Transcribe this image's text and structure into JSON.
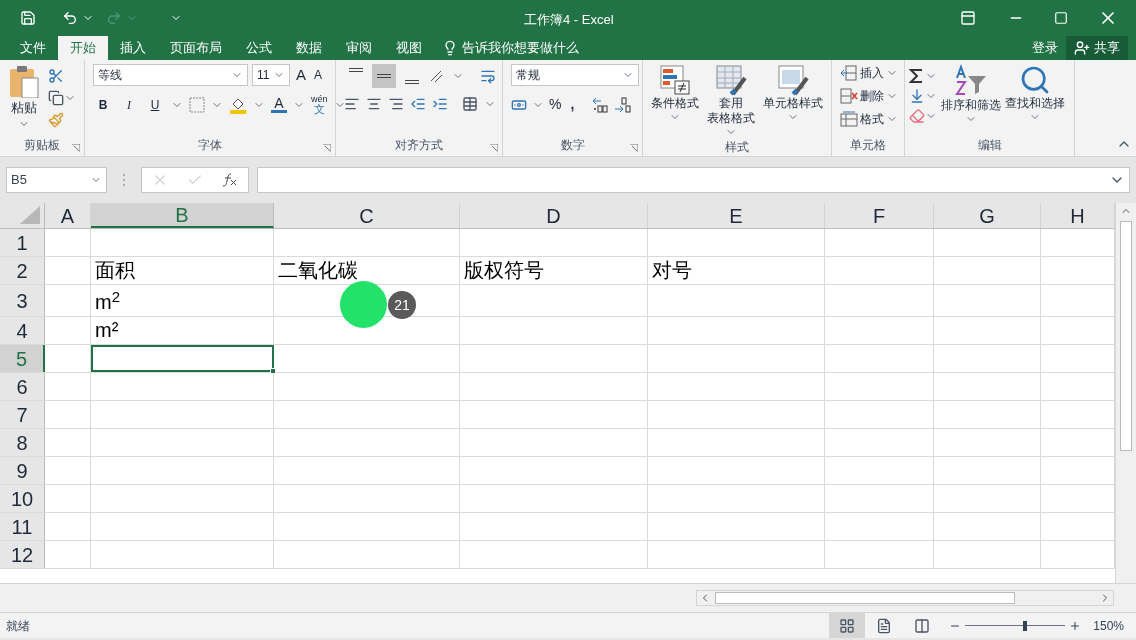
{
  "window": {
    "title": "工作簿4 - Excel"
  },
  "quick_access": {
    "redo_disabled": true
  },
  "menu_tabs": [
    {
      "label": "文件",
      "selected": false
    },
    {
      "label": "开始",
      "selected": true
    },
    {
      "label": "插入",
      "selected": false
    },
    {
      "label": "页面布局",
      "selected": false
    },
    {
      "label": "公式",
      "selected": false
    },
    {
      "label": "数据",
      "selected": false
    },
    {
      "label": "审阅",
      "selected": false
    },
    {
      "label": "视图",
      "selected": false
    }
  ],
  "tell_me": "告诉我你想要做什么",
  "sign_in": "登录",
  "share": "共享",
  "ribbon": {
    "clipboard": {
      "label": "剪贴板",
      "paste": "粘贴"
    },
    "font": {
      "label": "字体",
      "font_name": "等线",
      "font_size": "11",
      "grow": "A",
      "shrink": "A",
      "bold": "B",
      "italic": "I",
      "underline": "U",
      "font_color": "A",
      "phonetic_top": "wén",
      "phonetic_bottom": "文"
    },
    "alignment": {
      "label": "对齐方式",
      "vertical": [
        {
          "kind": "top",
          "selected": false
        },
        {
          "kind": "middle",
          "selected": true
        },
        {
          "kind": "bottom",
          "selected": false
        }
      ]
    },
    "number": {
      "label": "数字",
      "format": "常规",
      "percent": "%",
      "comma": ","
    },
    "styles": {
      "label": "样式",
      "buttons": [
        {
          "lines": [
            "条件格式"
          ],
          "kind": "conditional"
        },
        {
          "lines": [
            "套用",
            "表格格式"
          ],
          "kind": "table"
        },
        {
          "lines": [
            "单元格样式"
          ],
          "kind": "cell"
        }
      ]
    },
    "cells": {
      "label": "单元格",
      "items": [
        {
          "label": "插入",
          "kind": "insert"
        },
        {
          "label": "删除",
          "kind": "delete"
        },
        {
          "label": "格式",
          "kind": "format"
        }
      ]
    },
    "editing": {
      "label": "编辑",
      "buttons": [
        {
          "label": "排序和筛选",
          "kind": "sort"
        },
        {
          "label": "查找和选择",
          "kind": "find"
        }
      ]
    }
  },
  "name_box": "B5",
  "columns": [
    {
      "label": "A",
      "selected": false
    },
    {
      "label": "B",
      "selected": true
    },
    {
      "label": "C",
      "selected": false
    },
    {
      "label": "D",
      "selected": false
    },
    {
      "label": "E",
      "selected": false
    },
    {
      "label": "F",
      "selected": false
    },
    {
      "label": "G",
      "selected": false
    },
    {
      "label": "H",
      "selected": false
    }
  ],
  "rows": [
    {
      "label": "1",
      "selected": false,
      "tall": false,
      "cells": [
        null,
        null,
        null,
        null,
        null,
        null,
        null,
        null
      ]
    },
    {
      "label": "2",
      "selected": false,
      "tall": false,
      "cells": [
        null,
        "面积",
        "二氧化碳",
        "版权符号",
        "对号",
        null,
        null,
        null
      ]
    },
    {
      "label": "3",
      "selected": false,
      "tall": true,
      "cells": [
        null,
        "m$^{2}$",
        null,
        null,
        null,
        null,
        null,
        null
      ]
    },
    {
      "label": "4",
      "selected": false,
      "tall": false,
      "cells": [
        null,
        "m²",
        null,
        null,
        null,
        null,
        null,
        null
      ]
    },
    {
      "label": "5",
      "selected": true,
      "tall": false,
      "cells": [
        null,
        null,
        null,
        null,
        null,
        null,
        null,
        null
      ]
    },
    {
      "label": "6",
      "selected": false,
      "tall": false,
      "cells": [
        null,
        null,
        null,
        null,
        null,
        null,
        null,
        null
      ]
    },
    {
      "label": "7",
      "selected": false,
      "tall": false,
      "cells": [
        null,
        null,
        null,
        null,
        null,
        null,
        null,
        null
      ]
    },
    {
      "label": "8",
      "selected": false,
      "tall": false,
      "cells": [
        null,
        null,
        null,
        null,
        null,
        null,
        null,
        null
      ]
    },
    {
      "label": "9",
      "selected": false,
      "tall": false,
      "cells": [
        null,
        null,
        null,
        null,
        null,
        null,
        null,
        null
      ]
    },
    {
      "label": "10",
      "selected": false,
      "tall": false,
      "cells": [
        null,
        null,
        null,
        null,
        null,
        null,
        null,
        null
      ]
    },
    {
      "label": "11",
      "selected": false,
      "tall": false,
      "cells": [
        null,
        null,
        null,
        null,
        null,
        null,
        null,
        null
      ]
    },
    {
      "label": "12",
      "selected": false,
      "tall": false,
      "cells": [
        null,
        null,
        null,
        null,
        null,
        null,
        null,
        null
      ]
    }
  ],
  "click_marker": {
    "count": "21"
  },
  "status_bar": {
    "status": "就绪",
    "zoom": "150%",
    "zoom_slider": {
      "level": 0.6
    }
  }
}
